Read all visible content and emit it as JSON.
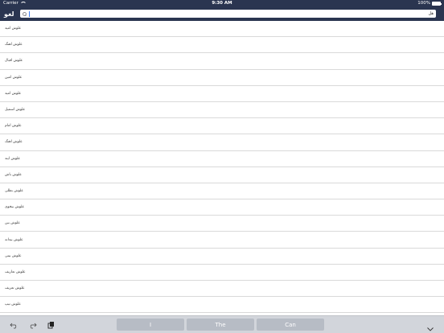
{
  "status_bar": {
    "carrier": "Carrier",
    "time": "9:30 AM",
    "battery": "100%"
  },
  "nav_bar": {
    "title": "لغو",
    "search_value": "هل"
  },
  "list": {
    "items": [
      "علوش امید",
      "علوش اهنگ",
      "علوش اقبال",
      "علوش امین",
      "علوش امید",
      "علوش اسمیل",
      "علوش امام",
      "علوش اهنگ",
      "علوش ایند",
      "علوش باش",
      "علوش بطلی",
      "علوش بیخوی",
      "علوش بین",
      "علوش بیدانه",
      "علوش بیتی",
      "علوش تعاریف",
      "علوش تعریف",
      "علوش تیپ"
    ]
  },
  "keyboard_bar": {
    "predictions": [
      "I",
      "The",
      "Can"
    ],
    "icons": [
      "undo-icon",
      "redo-icon",
      "paste-icon",
      "keyboard-dismiss-icon"
    ]
  }
}
